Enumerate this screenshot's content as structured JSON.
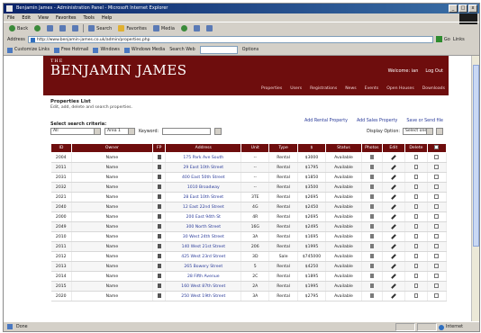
{
  "window": {
    "title": "Benjamin James - Administration Panel - Microsoft Internet Explorer",
    "buttons": {
      "minimize": "_",
      "maximize": "□",
      "close": "x"
    }
  },
  "menu": [
    "File",
    "Edit",
    "View",
    "Favorites",
    "Tools",
    "Help"
  ],
  "toolbar": {
    "back": "Back",
    "search": "Search",
    "favorites": "Favorites",
    "media": "Media"
  },
  "addressbar": {
    "label": "Address",
    "url": "http://www.benjamin-james.co.uk/admin/properties.php",
    "go": "Go",
    "links": "Links"
  },
  "linksbar": {
    "items": [
      "Customize Links",
      "Free Hotmail",
      "Windows",
      "Windows Media"
    ],
    "search_label": "Search Web",
    "extras": [
      "Options"
    ]
  },
  "site": {
    "logo_small": "THE",
    "logo_big": "BENJAMIN JAMES",
    "welcome": "Welcome: ian",
    "logout": "Log Out",
    "nav": [
      "Properties",
      "Users",
      "Registrations",
      "News",
      "Events",
      "Open Houses",
      "Downloads"
    ],
    "page_title": "Properties List",
    "page_sub": "Edit, add, delete and search properties.",
    "criteria_label": "Select search criteria:",
    "criteria_select1": "All",
    "criteria_select2": "Area 1",
    "keyword_label": "Keyword:",
    "links": [
      "Add Rental Property",
      "Add Sales Property",
      "Save or Send file"
    ],
    "display_label": "Display Option:",
    "display_value": "Select one"
  },
  "table": {
    "headers": [
      "ID",
      "Owner",
      "FP",
      "Address",
      "Unit",
      "Type",
      "$",
      "Status",
      "Photos",
      "Edit",
      "Delete",
      ""
    ],
    "rows": [
      {
        "id": "2004",
        "owner": "Name",
        "addr": "175 Park Ave South",
        "unit": "--",
        "type": "Rental",
        "price": "$3000",
        "status": "Available"
      },
      {
        "id": "2011",
        "owner": "Name",
        "addr": "29 East 10th Street",
        "unit": "--",
        "type": "Rental",
        "price": "$1795",
        "status": "Available"
      },
      {
        "id": "2031",
        "owner": "Name",
        "addr": "400 East 50th Street",
        "unit": "--",
        "type": "Rental",
        "price": "$1850",
        "status": "Available"
      },
      {
        "id": "2032",
        "owner": "Name",
        "addr": "1010 Broadway",
        "unit": "--",
        "type": "Rental",
        "price": "$3500",
        "status": "Available"
      },
      {
        "id": "2021",
        "owner": "Name",
        "addr": "28 East 10th Street",
        "unit": "3TE",
        "type": "Rental",
        "price": "$2695",
        "status": "Available"
      },
      {
        "id": "2040",
        "owner": "Name",
        "addr": "12 East 22nd Street",
        "unit": "4G",
        "type": "Rental",
        "price": "$2450",
        "status": "Available"
      },
      {
        "id": "2000",
        "owner": "Name",
        "addr": "200 East 94th St",
        "unit": "4R",
        "type": "Rental",
        "price": "$2695",
        "status": "Available"
      },
      {
        "id": "2049",
        "owner": "Name",
        "addr": "300 North Street",
        "unit": "16G",
        "type": "Rental",
        "price": "$2495",
        "status": "Available"
      },
      {
        "id": "2010",
        "owner": "Name",
        "addr": "30 West 24th Street",
        "unit": "3A",
        "type": "Rental",
        "price": "$1695",
        "status": "Available"
      },
      {
        "id": "2011",
        "owner": "Name",
        "addr": "140 West 21st Street",
        "unit": "206",
        "type": "Rental",
        "price": "$1995",
        "status": "Available"
      },
      {
        "id": "2012",
        "owner": "Name",
        "addr": "425 West 23rd Street",
        "unit": "3D",
        "type": "Sale",
        "price": "$745000",
        "status": "Available"
      },
      {
        "id": "2013",
        "owner": "Name",
        "addr": "265 Bowery Street",
        "unit": "5",
        "type": "Rental",
        "price": "$4250",
        "status": "Available"
      },
      {
        "id": "2014",
        "owner": "Name",
        "addr": "28 Fifth Avenue",
        "unit": "2C",
        "type": "Rental",
        "price": "$1895",
        "status": "Available"
      },
      {
        "id": "2015",
        "owner": "Name",
        "addr": "160 West 87th Street",
        "unit": "2A",
        "type": "Rental",
        "price": "$1995",
        "status": "Available"
      },
      {
        "id": "2020",
        "owner": "Name",
        "addr": "250 West 19th Street",
        "unit": "3A",
        "type": "Rental",
        "price": "$2795",
        "status": "Available"
      }
    ]
  },
  "status": {
    "text": "Done",
    "zone": "Internet"
  }
}
